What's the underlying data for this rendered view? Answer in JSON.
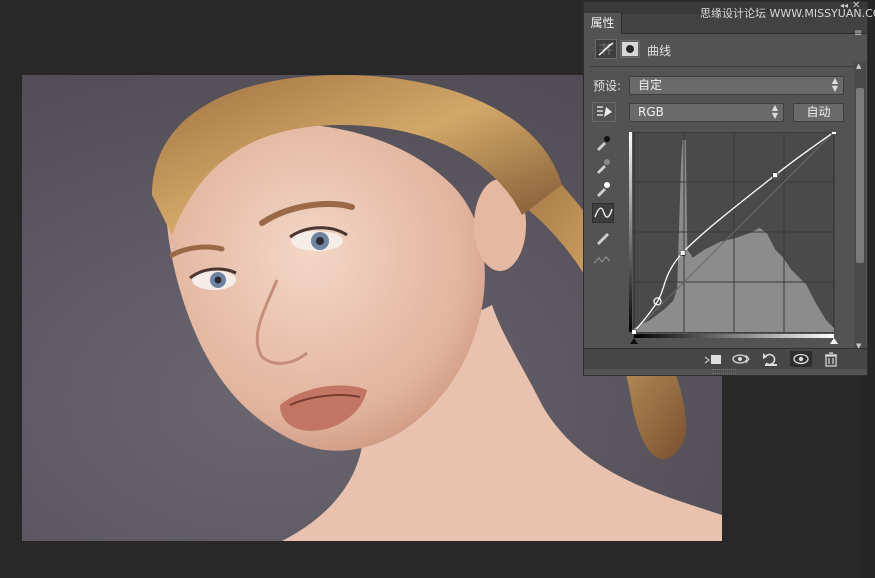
{
  "panel": {
    "tab_label": "属性",
    "adjustment_title": "曲线",
    "watermark": "思缘设计论坛 WWW.MISSYUAN.COM",
    "preset_label": "预设:",
    "preset_value": "自定",
    "channel_value": "RGB",
    "auto_button": "自动"
  },
  "curve": {
    "input_output_points": [
      [
        0,
        0
      ],
      [
        30,
        39
      ],
      [
        62,
        101
      ],
      [
        180,
        200
      ],
      [
        255,
        255
      ]
    ],
    "histogram_peak_channel_input": 62
  },
  "colors": {
    "panel_bg": "#535353",
    "canvas_bg": "#282828",
    "graph_bg": "#4a4a4a",
    "histogram": "#8c8c8c",
    "curve": "#ffffff"
  },
  "icons": [
    "curves-adjustment-icon",
    "mask-icon",
    "on-image-adjust-icon",
    "black-point-eyedropper-icon",
    "gray-point-eyedropper-icon",
    "white-point-eyedropper-icon",
    "curve-points-icon",
    "pencil-icon",
    "smooth-icon",
    "clip-to-layer-icon",
    "view-previous-state-icon",
    "reset-icon",
    "visibility-eye-icon",
    "trash-icon"
  ]
}
